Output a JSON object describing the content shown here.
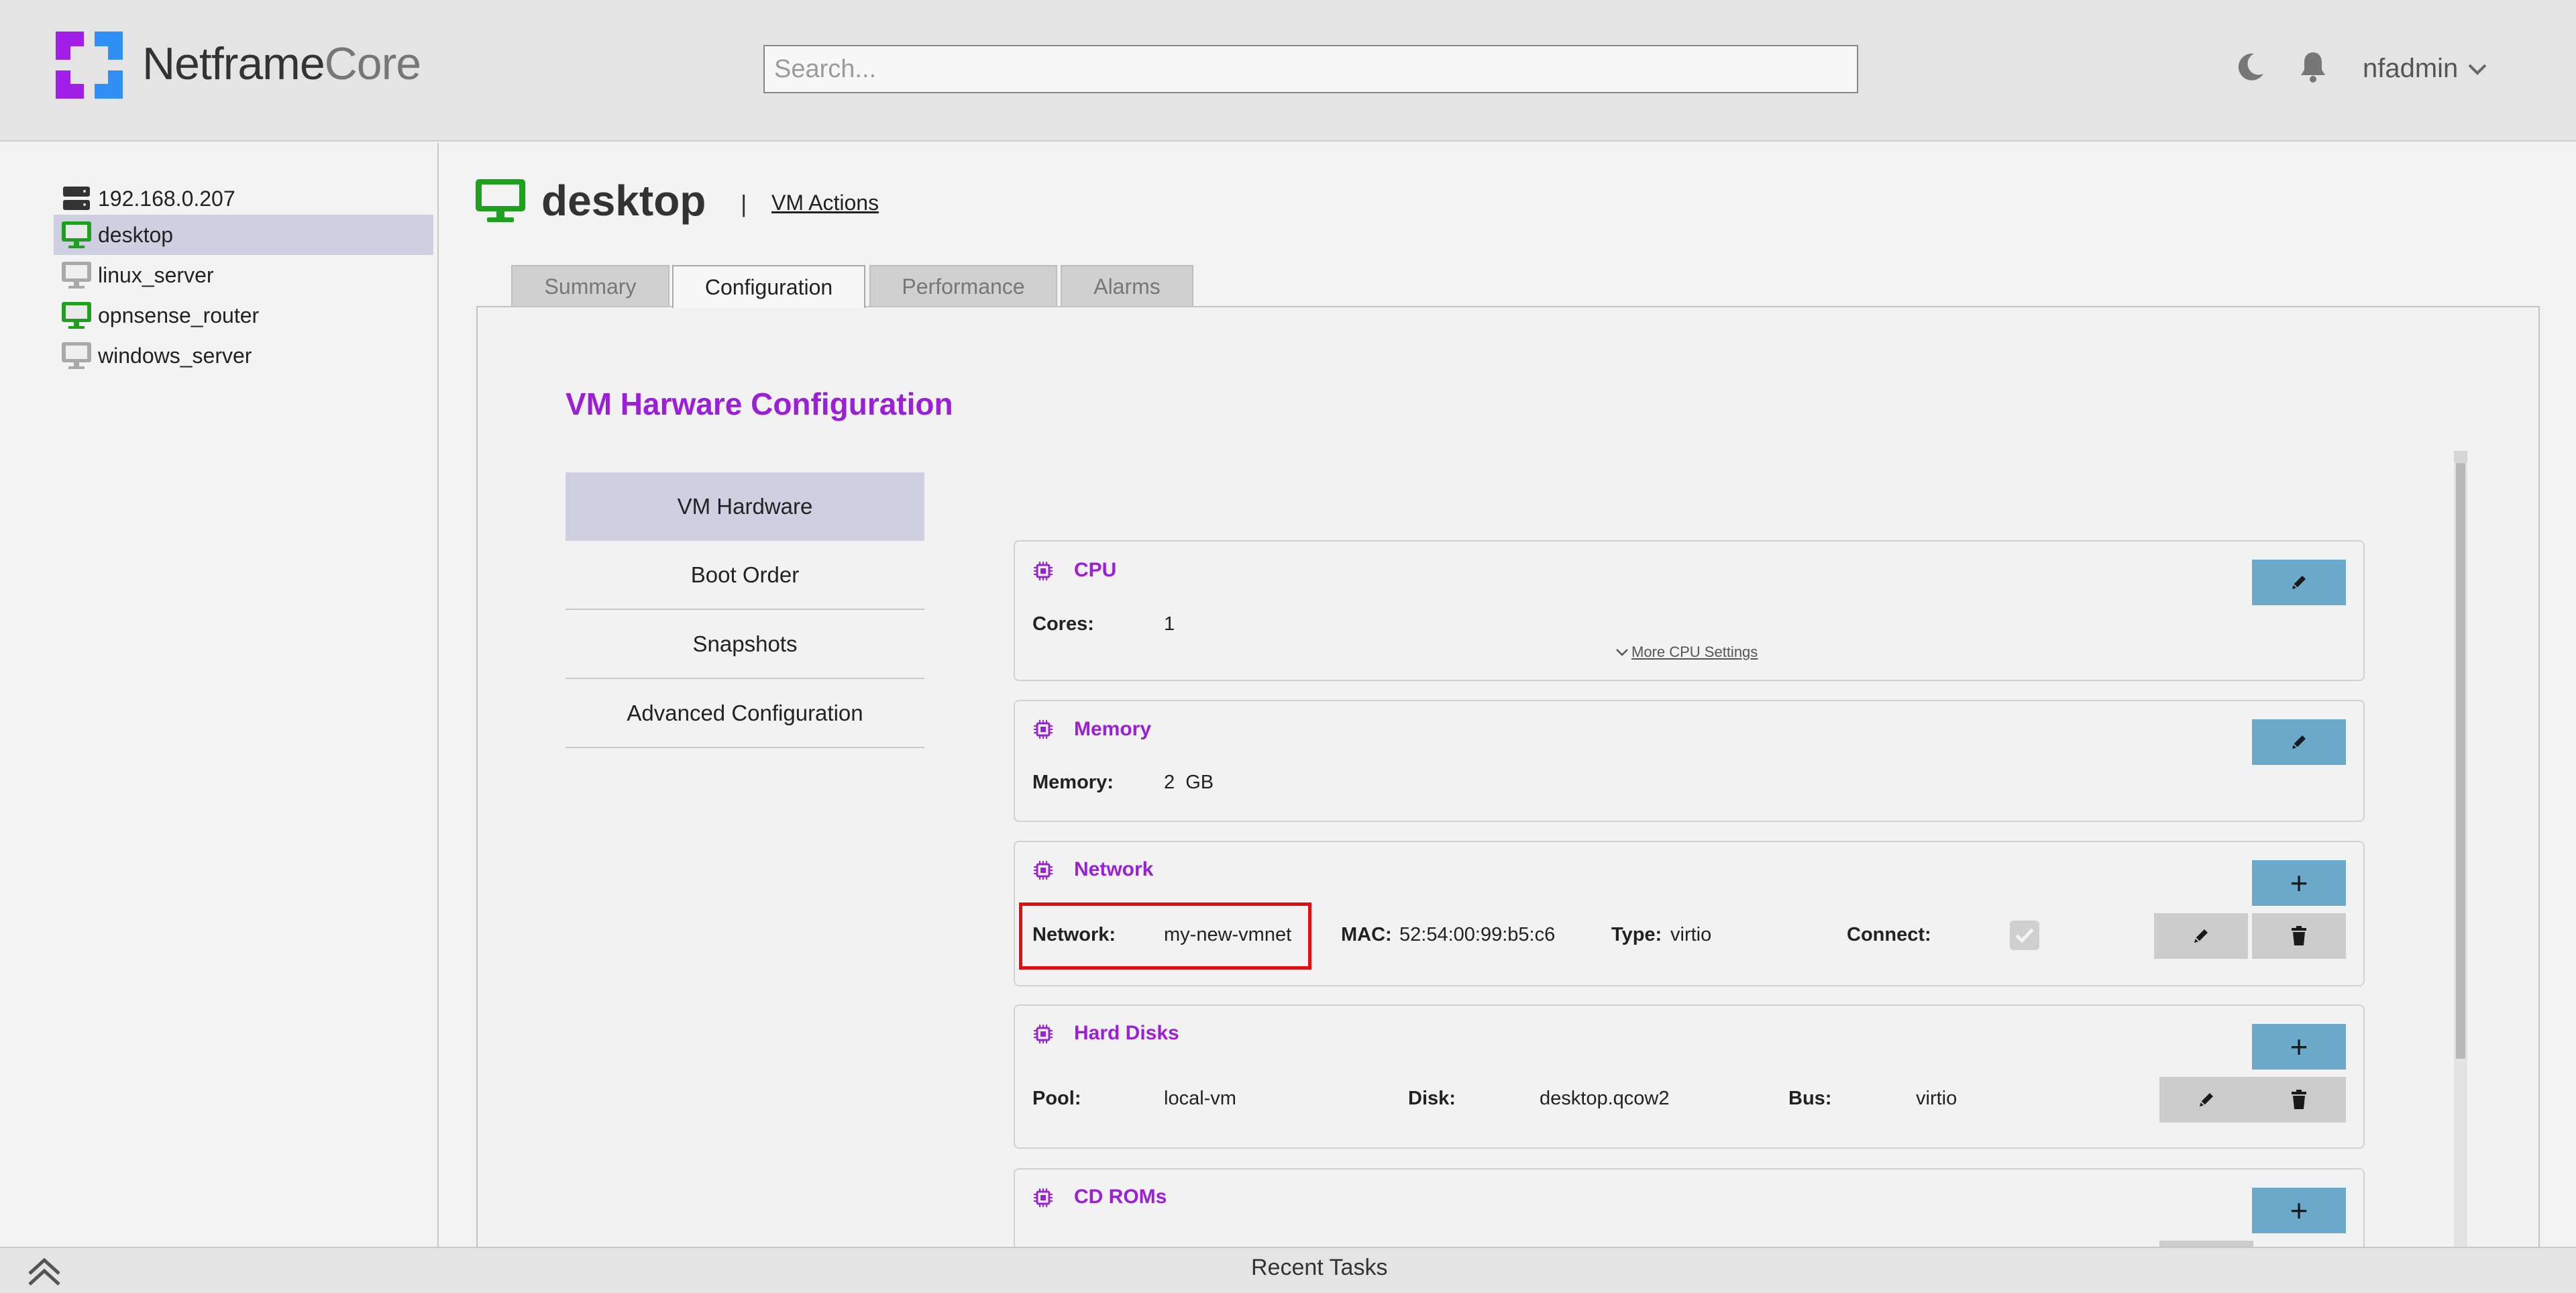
{
  "app": {
    "brand_part1": "Netframe",
    "brand_part2": "Core",
    "search_placeholder": "Search...",
    "user": "nfadmin",
    "accent_color": "#9a1fd6",
    "logo_colors": [
      "#a21fe8",
      "#2f8ff5"
    ]
  },
  "sidebar": {
    "items": [
      {
        "label": "192.168.0.207",
        "icon": "server-icon",
        "status": "host"
      },
      {
        "label": "desktop",
        "icon": "monitor-icon",
        "status": "running",
        "selected": true
      },
      {
        "label": "linux_server",
        "icon": "monitor-icon",
        "status": "stopped"
      },
      {
        "label": "opnsense_router",
        "icon": "monitor-icon",
        "status": "running"
      },
      {
        "label": "windows_server",
        "icon": "monitor-icon",
        "status": "stopped"
      }
    ]
  },
  "vm": {
    "name": "desktop",
    "separator": "|",
    "actions_label": "VM Actions"
  },
  "tabs": [
    "Summary",
    "Configuration",
    "Performance",
    "Alarms"
  ],
  "active_tab": "Configuration",
  "config": {
    "title": "VM Harware Configuration",
    "menu": [
      "VM Hardware",
      "Boot Order",
      "Snapshots",
      "Advanced Configuration"
    ],
    "active_menu": "VM Hardware",
    "cpu": {
      "title": "CPU",
      "cores_label": "Cores:",
      "cores_value": "1",
      "more_label": "More CPU Settings"
    },
    "memory": {
      "title": "Memory",
      "memory_label": "Memory:",
      "memory_value": "2  GB"
    },
    "network": {
      "title": "Network",
      "add_label": "+",
      "network_label": "Network:",
      "network_value": "my-new-vmnet",
      "mac_label": "MAC:",
      "mac_value": "52:54:00:99:b5:c6",
      "type_label": "Type:",
      "type_value": "virtio",
      "connect_label": "Connect:",
      "connect_checked": true
    },
    "disks": {
      "title": "Hard Disks",
      "add_label": "+",
      "pool_label": "Pool:",
      "pool_value": "local-vm",
      "disk_label": "Disk:",
      "disk_value": "desktop.qcow2",
      "bus_label": "Bus:",
      "bus_value": "virtio"
    },
    "cdroms": {
      "title": "CD ROMs",
      "add_label": "+"
    }
  },
  "footer": {
    "recent_tasks": "Recent Tasks"
  }
}
